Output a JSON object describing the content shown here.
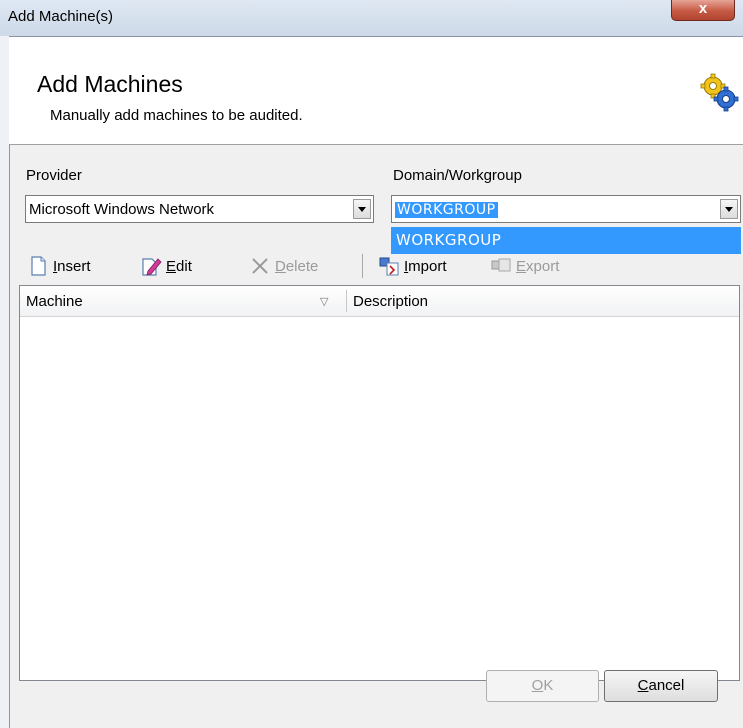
{
  "window": {
    "title": "Add Machine(s)",
    "close_label": "x"
  },
  "header": {
    "title": "Add Machines",
    "subtitle": "Manually add machines to be audited.",
    "icon": "gears-icon"
  },
  "provider": {
    "label": "Provider",
    "value": "Microsoft Windows Network"
  },
  "domain": {
    "label": "Domain/Workgroup",
    "value": "WORKGROUP",
    "options": [
      "WORKGROUP"
    ]
  },
  "toolbar": {
    "insert": {
      "prefix": "I",
      "rest": "nsert",
      "icon": "document-icon"
    },
    "edit": {
      "prefix": "E",
      "rest": "dit",
      "icon": "edit-pencil-icon"
    },
    "delete": {
      "prefix": "D",
      "rest": "elete",
      "icon": "delete-x-icon"
    },
    "import": {
      "prefix": "I",
      "rest": "mport",
      "icon": "import-icon"
    },
    "export": {
      "prefix": "E",
      "rest": "xport",
      "icon": "export-icon"
    }
  },
  "grid": {
    "columns": [
      "Machine",
      "Description"
    ],
    "sort_glyph": "▽",
    "rows": []
  },
  "buttons": {
    "ok": {
      "prefix": "O",
      "rest": "K"
    },
    "cancel": {
      "prefix": "C",
      "rest": "ancel"
    }
  },
  "colors": {
    "selection": "#3399ff",
    "close": "#c55a44"
  }
}
